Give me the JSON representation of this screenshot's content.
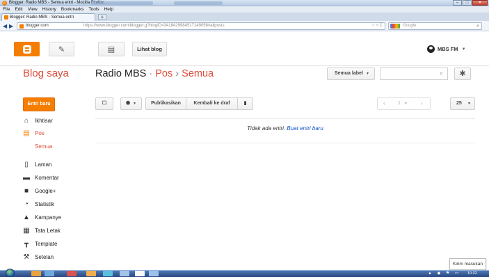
{
  "window": {
    "title": "Blogger: Radio MBS - Semua entri - Mozilla Firefox",
    "controls": [
      "–",
      "□",
      "✕"
    ]
  },
  "menu": [
    "File",
    "Edit",
    "View",
    "History",
    "Bookmarks",
    "Tools",
    "Help"
  ],
  "tabs": [
    {
      "label": "Blogger: Radio MBS - Semua entri"
    }
  ],
  "new_tab_label": "+",
  "address_bar": {
    "domain": "blogger.com",
    "url_rest": "https://www.blogger.com/blogger.g?blogID=3418429984517149058#allposts",
    "icons": "☆ ▿ C"
  },
  "browser_search": {
    "placeholder": "Google"
  },
  "toolbar": {
    "view_blog_label": "Lihat blog",
    "user_name": "MBS FM"
  },
  "header": {
    "my_blogs": "Blog saya",
    "blog_name": "Radio MBS",
    "sep1": "·",
    "section": "Pos",
    "sep2": "›",
    "current": "Semua",
    "labels_select": "Semua label"
  },
  "sidebar": {
    "new_post": "Entri baru",
    "items": [
      {
        "label": "Ikhtisar",
        "icon": "home-icon"
      },
      {
        "label": "Pos",
        "icon": "posts-icon",
        "active": true
      },
      {
        "label": "Semua",
        "sub": true
      },
      {
        "label": "Laman",
        "icon": "pages-icon"
      },
      {
        "label": "Komentar",
        "icon": "comments-icon"
      },
      {
        "label": "Google+",
        "icon": "google-plus-icon"
      },
      {
        "label": "Statistik",
        "icon": "stats-icon"
      },
      {
        "label": "Kampanye",
        "icon": "campaign-icon"
      },
      {
        "label": "Tata Letak",
        "icon": "layout-icon"
      },
      {
        "label": "Template",
        "icon": "template-icon"
      },
      {
        "label": "Setelan",
        "icon": "settings-wrench-icon"
      }
    ]
  },
  "post_toolbar": {
    "publish": "Publikasikan",
    "revert_draft": "Kembali ke draf",
    "page": "1",
    "per_page": "25"
  },
  "empty_state": {
    "text": "Tidak ada entri.",
    "link": "Buat entri baru"
  },
  "feedback": "Kirim masukan",
  "clock": "10:32",
  "colors": {
    "accent": "#f57d00",
    "heading_red": "#dd4b39",
    "link": "#1155cc"
  }
}
